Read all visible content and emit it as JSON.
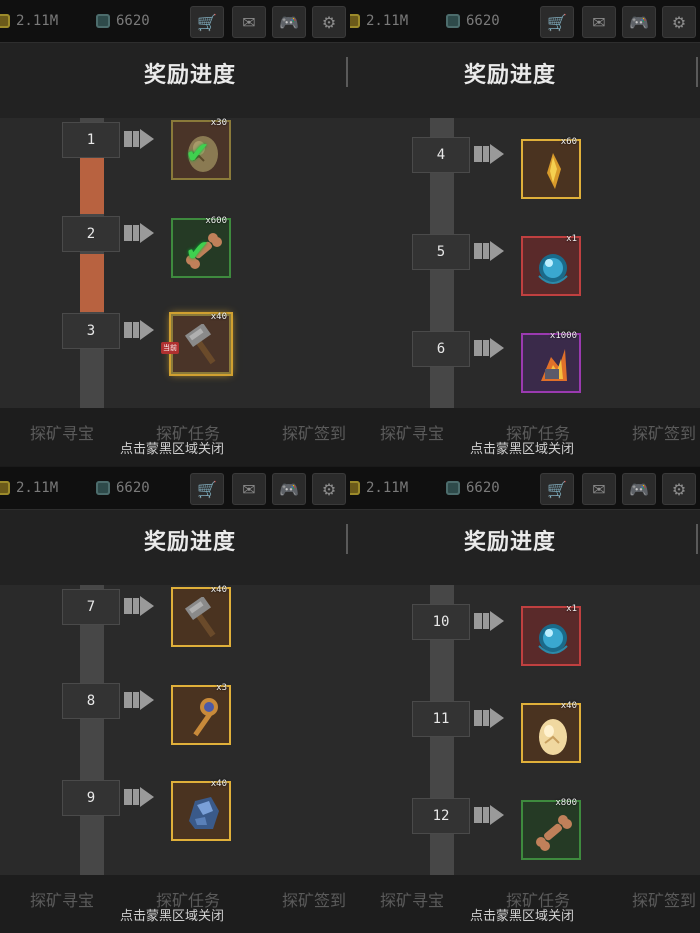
{
  "status": {
    "coins": "2.11M",
    "gems": "6620"
  },
  "header": {
    "title": "奖励进度"
  },
  "footer": {
    "tabs": [
      "探矿寻宝",
      "探矿任务",
      "探矿签到"
    ],
    "close_hint": "点击蒙黑区域关闭"
  },
  "current_tag": "当前",
  "screens": [
    {
      "id": "s1",
      "levels": [
        {
          "num": "1",
          "qty": "x30",
          "frame": "brown",
          "item": "egg",
          "claimed": true
        },
        {
          "num": "2",
          "qty": "x600",
          "frame": "green",
          "item": "bone",
          "claimed": true
        },
        {
          "num": "3",
          "qty": "x40",
          "frame": "brown",
          "item": "hammer",
          "current": true
        }
      ]
    },
    {
      "id": "s2",
      "levels": [
        {
          "num": "4",
          "qty": "x60",
          "frame": "gold",
          "item": "shard"
        },
        {
          "num": "5",
          "qty": "x1",
          "frame": "red",
          "item": "orb"
        },
        {
          "num": "6",
          "qty": "x1000",
          "frame": "purple",
          "item": "fire"
        }
      ]
    },
    {
      "id": "s3",
      "levels": [
        {
          "num": "7",
          "qty": "x40",
          "frame": "gold",
          "item": "hammer"
        },
        {
          "num": "8",
          "qty": "x3",
          "frame": "gold",
          "item": "key"
        },
        {
          "num": "9",
          "qty": "x40",
          "frame": "gold",
          "item": "ore"
        }
      ]
    },
    {
      "id": "s4",
      "levels": [
        {
          "num": "10",
          "qty": "x1",
          "frame": "red",
          "item": "orb"
        },
        {
          "num": "11",
          "qty": "x40",
          "frame": "gold",
          "item": "egg2"
        },
        {
          "num": "12",
          "qty": "x800",
          "frame": "green",
          "item": "bone"
        }
      ]
    }
  ],
  "colors": {
    "progress_fill": "#b86240",
    "track": "#474747",
    "claimed_check": "#3fd04f"
  }
}
